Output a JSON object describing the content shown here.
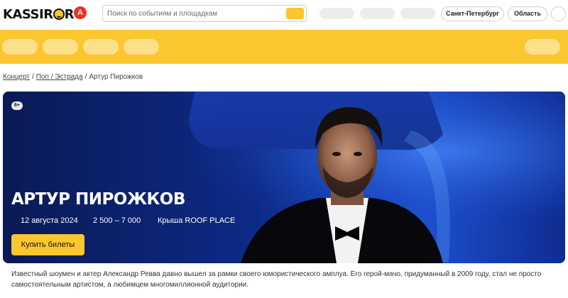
{
  "header": {
    "logo_text_1": "KASSIR",
    "logo_text_2": "RU",
    "partner_badge": "А",
    "search": {
      "placeholder": "Поиск по событиям и площадкам"
    },
    "city_button": "Санкт-Петербург",
    "region_button": "Область"
  },
  "breadcrumb": {
    "items": [
      "Концерт",
      "Поп / Эстрада",
      "Артур Пирожков"
    ],
    "separator": "/"
  },
  "hero": {
    "age_rating": "6+",
    "title": "АРТУР ПИРОЖКОВ",
    "date": "12 августа 2024",
    "price": "2 500 – 7 000",
    "venue": "Крыша ROOF PLACE",
    "buy_label": "Купить билеты"
  },
  "description": "Известный шоумен и актер Александр Ревва давно вышел за рамки своего юмористического амплуа. Его герой-мачо, придуманный в 2009 году, стал не просто самостоятельным артистом, а любимцем многомиллионной аудитории.",
  "colors": {
    "accent_yellow": "#fcc62f",
    "hero_blue": "#0b1f63",
    "alfa_red": "#ef3124"
  },
  "icons": [
    "logo-smile-icon",
    "search-icon",
    "user-icon"
  ]
}
